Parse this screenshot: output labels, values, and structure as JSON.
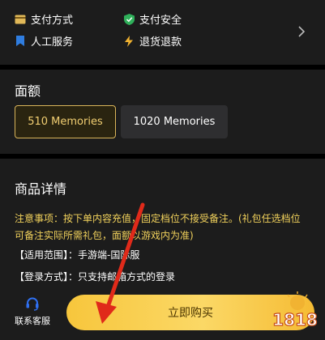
{
  "services": {
    "pay_method": "支付方式",
    "pay_safety": "支付安全",
    "human_service": "人工服务",
    "refund": "退货退款"
  },
  "amount": {
    "title": "面额",
    "options": [
      "510 Memories",
      "1020 Memories"
    ],
    "selected": "510 Memories"
  },
  "details": {
    "title": "商品详情",
    "notice": "注意事项：按下单内容充值，固定档位不接受备注。(礼包任选档位可备注实际所需礼包，面额以游戏内为准)",
    "range": "【适用范围】：手游端-国际服",
    "login": "【登录方式】：只支持邮箱方式的登录"
  },
  "bottom": {
    "support": "联系客服",
    "buy": "立即购买"
  },
  "watermark": "1818",
  "colors": {
    "accent": "#d9b45a",
    "notice": "#f2d25c",
    "button": "#f7c63c",
    "card": "#1c1c1c",
    "background": "#000000"
  }
}
